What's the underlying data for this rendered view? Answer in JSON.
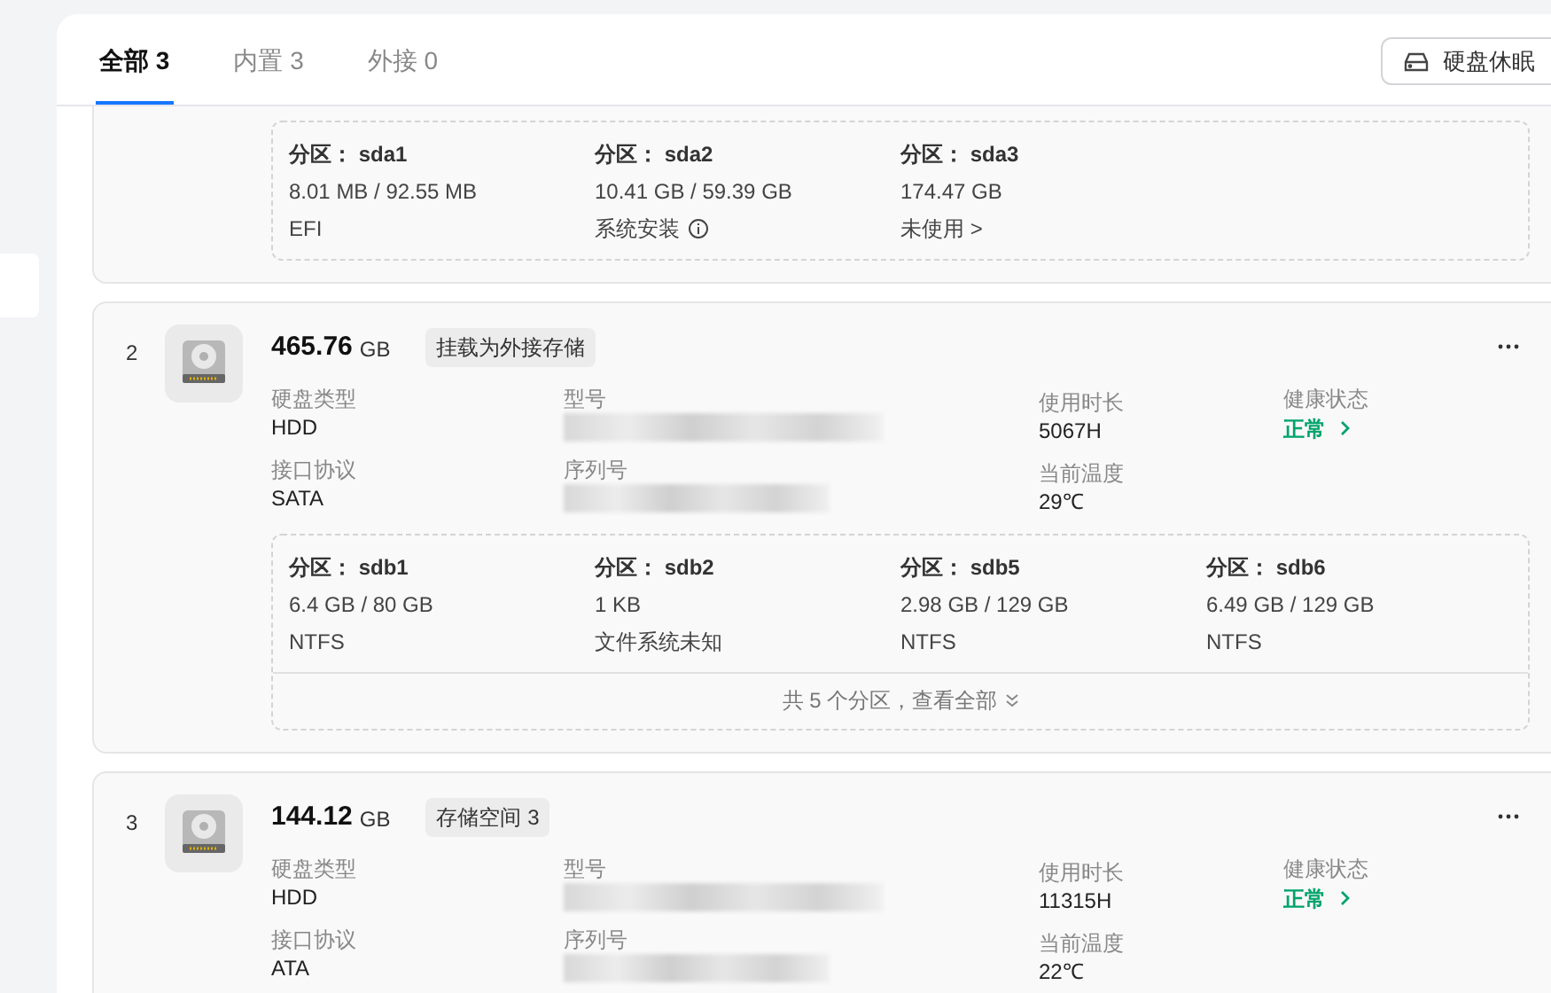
{
  "tabs": [
    {
      "label": "全部 3",
      "selected": true
    },
    {
      "label": "内置 3",
      "selected": false
    },
    {
      "label": "外接 0",
      "selected": false
    }
  ],
  "sleep_button": {
    "label": "硬盘休眠"
  },
  "disks": [
    {
      "partitions": [
        {
          "label": "分区：",
          "name": "sda1",
          "usage": "8.01 MB / 92.55 MB",
          "fs": "EFI",
          "info": false
        },
        {
          "label": "分区：",
          "name": "sda2",
          "usage": "10.41 GB / 59.39 GB",
          "fs": "系统安装",
          "info": true
        },
        {
          "label": "分区：",
          "name": "sda3",
          "usage": "174.47 GB",
          "fs": "未使用 >",
          "info": false
        }
      ]
    },
    {
      "index": "2",
      "size": "465.76",
      "unit": "GB",
      "tag": "挂载为外接存储",
      "type_label": "硬盘类型",
      "type": "HDD",
      "protocol_label": "接口协议",
      "protocol": "SATA",
      "model_label": "型号",
      "serial_label": "序列号",
      "hours_label": "使用时长",
      "hours": "5067H",
      "temp_label": "当前温度",
      "temp": "29℃",
      "health_label": "健康状态",
      "health": "正常",
      "partitions": [
        {
          "label": "分区：",
          "name": "sdb1",
          "usage": "6.4 GB / 80 GB",
          "fs": "NTFS",
          "info": false
        },
        {
          "label": "分区：",
          "name": "sdb2",
          "usage": "1 KB",
          "fs": "文件系统未知",
          "info": false
        },
        {
          "label": "分区：",
          "name": "sdb5",
          "usage": "2.98 GB / 129 GB",
          "fs": "NTFS",
          "info": false
        },
        {
          "label": "分区：",
          "name": "sdb6",
          "usage": "6.49 GB / 129 GB",
          "fs": "NTFS",
          "info": false
        }
      ],
      "footer": "共 5 个分区，查看全部"
    },
    {
      "index": "3",
      "size": "144.12",
      "unit": "GB",
      "tag": "存储空间 3",
      "type_label": "硬盘类型",
      "type": "HDD",
      "protocol_label": "接口协议",
      "protocol": "ATA",
      "model_label": "型号",
      "serial_label": "序列号",
      "hours_label": "使用时长",
      "hours": "11315H",
      "temp_label": "当前温度",
      "temp": "22℃",
      "health_label": "健康状态",
      "health": "正常"
    }
  ]
}
